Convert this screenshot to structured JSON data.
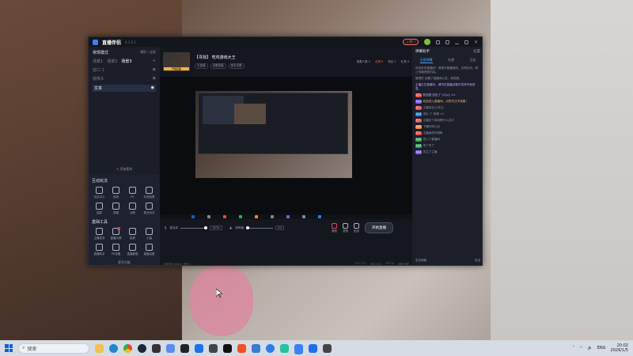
{
  "window": {
    "app_title": "直播伴侣",
    "version": "4.1.0.1"
  },
  "topbar": {
    "hot_label": "上热门",
    "icons": [
      "bell-icon",
      "feedback-icon",
      "minimize-icon",
      "maximize-icon",
      "close-icon"
    ]
  },
  "scene": {
    "header": "常规模式",
    "header_actions": "横屏 | 竖屏",
    "tabs": [
      "场景1",
      "场景2",
      "场景3"
    ],
    "sources": [
      {
        "name": "窗口 1",
        "meta": ""
      },
      {
        "name": "摄像头",
        "meta": ""
      },
      {
        "name": "文本",
        "meta": ""
      }
    ],
    "add_scene": "+ 添加素材"
  },
  "tools": {
    "interactive_title": "互动玩法",
    "interactive": [
      "玩法中心",
      "连线",
      "PK",
      "礼物投票",
      "抽奖",
      "答题",
      "点歌",
      "更多玩法"
    ],
    "basic_title": "基础工具",
    "basic": [
      "主播任务",
      "直播大屏",
      "投屏",
      "小窗",
      "直播助手",
      "PK设置",
      "直播数据",
      "直播设置"
    ],
    "more": "更多功能"
  },
  "stream": {
    "room_title": "【寻找】 吃鸡游戏大王",
    "chips": [
      "去直播",
      "设置直播",
      "更多设置"
    ],
    "stats": [
      "观看人数 0",
      "点赞 0",
      "粉丝 0",
      "礼物 0"
    ],
    "thumb_caption": "开播画面"
  },
  "controls": {
    "mic_label": "麦克风",
    "mic_value": "100%",
    "speaker_label": "扬声器",
    "speaker_value": "0%",
    "buttons": [
      "美颜",
      "滤镜",
      "贴纸"
    ],
    "start_label": "开始直播"
  },
  "statusbar": {
    "left": "当前码率 0kb/s | 丢帧 0",
    "right": [
      "CPU 12%",
      "内存 32%",
      "FPS 30",
      "网络 良好"
    ]
  },
  "chat": {
    "title": "弹幕助手",
    "head_actions": "设置",
    "tabs": [
      "全部弹幕",
      "礼物",
      "互动"
    ],
    "messages": [
      {
        "tag": "",
        "text": "欢迎来到直播间！请遵守直播规范，文明互动，禁止传播违规内容。",
        "style": ""
      },
      {
        "tag": "",
        "text": "管理员 设置了直播间公告，请查看。",
        "style": ""
      },
      {
        "tag": "",
        "text": "主播正在直播中，请勿在直播过程中发布不良信息。",
        "style": "hl"
      },
      {
        "tag": "红人",
        "text": "粉丝团 送出了 小心心 ×1",
        "style": "hl"
      },
      {
        "tag": "Lv.1",
        "text": "欢迎进入直播间，点赞关注不迷路！",
        "style": "warm"
      },
      {
        "tag": "红人",
        "text": "主播加油 已关注",
        "style": ""
      },
      {
        "tag": "Lv.2",
        "text": "送出 了 玫瑰 ×1",
        "style": ""
      },
      {
        "tag": "红人",
        "text": "主播这个游戏是什么名字",
        "style": ""
      },
      {
        "tag": "Lv.3",
        "text": "下播时间几点",
        "style": ""
      },
      {
        "tag": "红人",
        "text": "主播画质好清晰",
        "style": ""
      },
      {
        "tag": "Lv.1",
        "text": "进入了直播间",
        "style": ""
      },
      {
        "tag": "Lv.5",
        "text": "来了来了",
        "style": ""
      },
      {
        "tag": "Lv.2",
        "text": "关注了主播",
        "style": ""
      }
    ],
    "input_placeholder": "发送弹幕",
    "send": "发送"
  },
  "taskbar": {
    "search_placeholder": "搜索",
    "apps": [
      "file-explorer",
      "edge",
      "chrome",
      "steam",
      "terminal",
      "store",
      "app1",
      "app2",
      "app3",
      "app4",
      "app5",
      "app6",
      "app7",
      "app8",
      "app9",
      "app10",
      "app11"
    ],
    "lang": "ENG",
    "time": "20:02",
    "date": "2026/1/5"
  },
  "colors": {
    "accent": "#3b82f6",
    "alert": "#ff6a5a",
    "window_bg": "#15171f",
    "taskbar_bg": "#d6dbe4"
  }
}
